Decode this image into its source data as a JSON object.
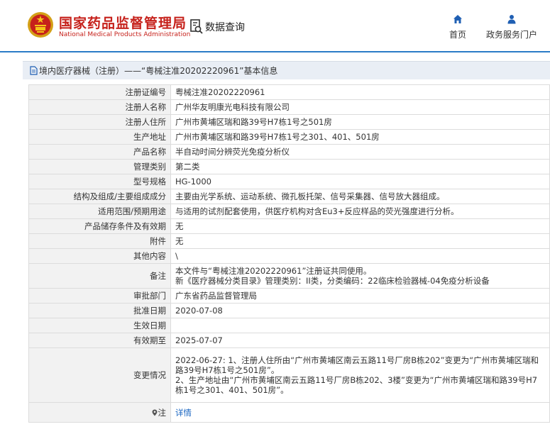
{
  "header": {
    "site_title": "国家药品监督管理局",
    "site_subtitle": "National Medical Products Administration",
    "query_label": "数据查询",
    "nav": [
      {
        "label": "首页",
        "icon": "home-icon"
      },
      {
        "label": "政务服务门户",
        "icon": "user-icon"
      }
    ],
    "brand_color": "#c6211b",
    "accent_color": "#2a7cc7"
  },
  "breadcrumb": "境内医疗器械（注册）——“粤械注准20202220961”基本信息",
  "table": {
    "rows": [
      {
        "label": "注册证编号",
        "value": "粤械注准20202220961"
      },
      {
        "label": "注册人名称",
        "value": "广州华友明康光电科技有限公司"
      },
      {
        "label": "注册人住所",
        "value": "广州市黄埔区瑞和路39号H7栋1号之501房"
      },
      {
        "label": "生产地址",
        "value": "广州市黄埔区瑞和路39号H7栋1号之301、401、501房"
      },
      {
        "label": "产品名称",
        "value": "半自动时间分辨荧光免疫分析仪"
      },
      {
        "label": "管理类别",
        "value": "第二类"
      },
      {
        "label": "型号规格",
        "value": "HG-1000"
      },
      {
        "label": "结构及组成/主要组成成分",
        "value": "主要由光学系统、运动系统、微孔板托架、信号采集器、信号放大器组成。"
      },
      {
        "label": "适用范围/预期用途",
        "value": "与适用的试剂配套使用，供医疗机构对含Eu3+反应样品的荧光强度进行分析。"
      },
      {
        "label": "产品储存条件及有效期",
        "value": "无"
      },
      {
        "label": "附件",
        "value": "无"
      },
      {
        "label": "其他内容",
        "value": "\\"
      },
      {
        "label": "备注",
        "lines": [
          "本文件与“粤械注准20202220961”注册证共同使用。",
          "新《医疗器械分类目录》管理类别：II类，分类编码：22临床检验器械-04免疫分析设备"
        ]
      },
      {
        "label": "审批部门",
        "value": "广东省药品监督管理局"
      },
      {
        "label": "批准日期",
        "value": "2020-07-08"
      },
      {
        "label": "生效日期",
        "value": ""
      },
      {
        "label": "有效期至",
        "value": "2025-07-07"
      },
      {
        "label": "变更情况",
        "lines": [
          "2022-06-27: 1、注册人住所由“广州市黄埔区南云五路11号厂房B栋202”变更为“广州市黄埔区瑞和路39号H7栋1号之501房”。",
          "2、生产地址由“广州市黄埔区南云五路11号厂房B栋202、3楼”变更为“广州市黄埔区瑞和路39号H7栋1号之301、401、501房”。"
        ]
      }
    ],
    "note": {
      "label": "注",
      "link_text": "详情",
      "icon": "pin-icon"
    }
  }
}
